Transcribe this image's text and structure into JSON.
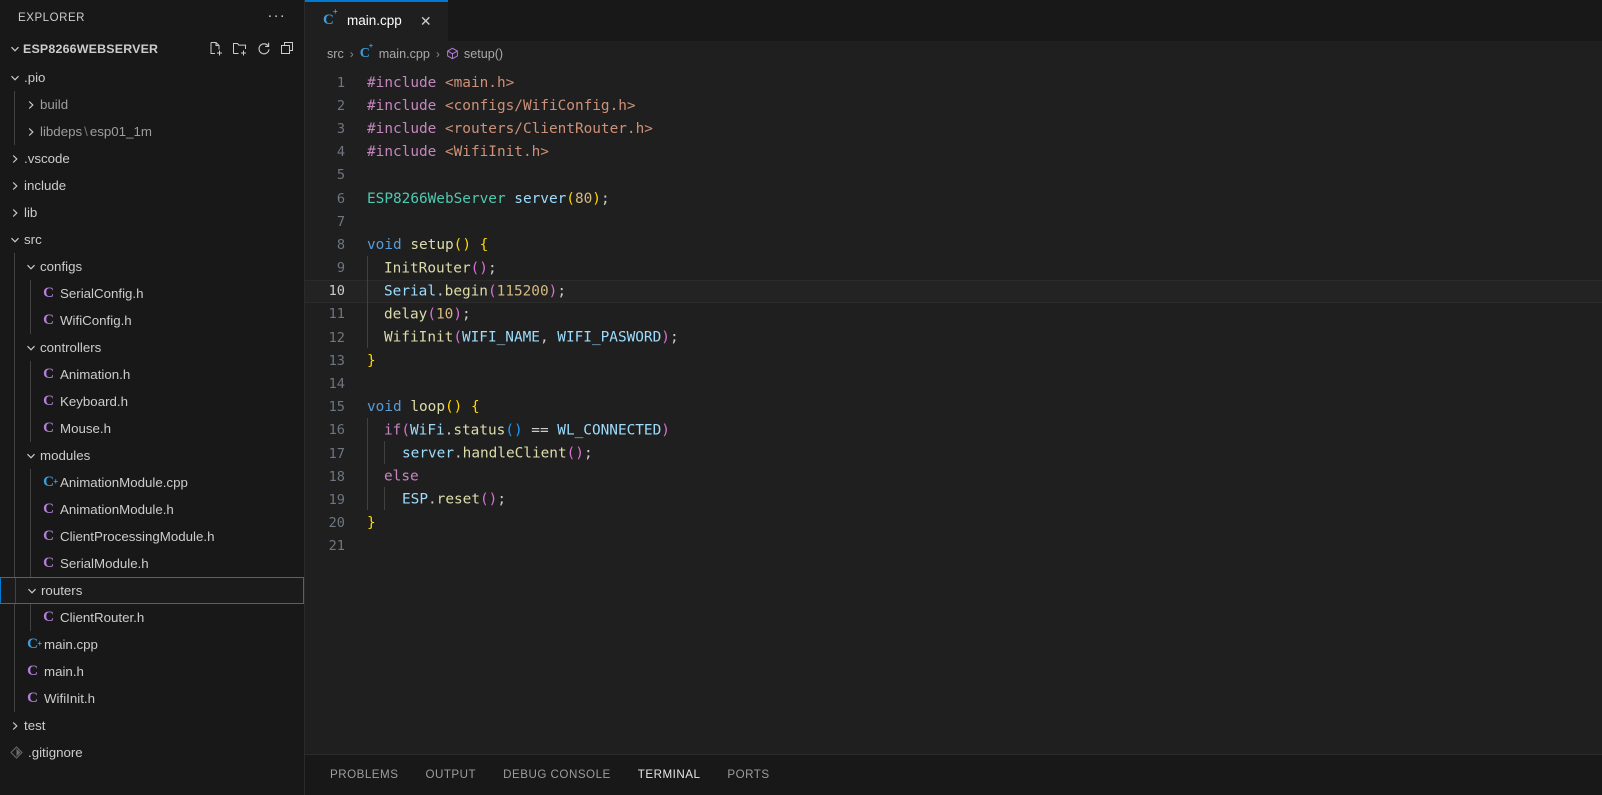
{
  "sidebar": {
    "header_title": "EXPLORER",
    "more_actions_label": "···",
    "project_name": "ESP8266WEBSERVER",
    "actions": [
      {
        "name": "new-file-icon",
        "label": "New File"
      },
      {
        "name": "new-folder-icon",
        "label": "New Folder"
      },
      {
        "name": "refresh-icon",
        "label": "Refresh Explorer"
      },
      {
        "name": "collapse-all-icon",
        "label": "Collapse Folders in Explorer"
      }
    ],
    "tree": [
      {
        "label": ".pio",
        "type": "folder",
        "state": "open",
        "depth": 0
      },
      {
        "label": "build",
        "type": "folder",
        "state": "closed",
        "depth": 1
      },
      {
        "label": "libdeps",
        "label2": "esp01_1m",
        "type": "folder",
        "state": "closed",
        "depth": 1
      },
      {
        "label": ".vscode",
        "type": "folder",
        "state": "closed",
        "depth": 0
      },
      {
        "label": "include",
        "type": "folder",
        "state": "closed",
        "depth": 0
      },
      {
        "label": "lib",
        "type": "folder",
        "state": "closed",
        "depth": 0
      },
      {
        "label": "src",
        "type": "folder",
        "state": "open",
        "depth": 0
      },
      {
        "label": "configs",
        "type": "folder",
        "state": "open",
        "depth": 1
      },
      {
        "label": "SerialConfig.h",
        "type": "header",
        "depth": 2
      },
      {
        "label": "WifiConfig.h",
        "type": "header",
        "depth": 2
      },
      {
        "label": "controllers",
        "type": "folder",
        "state": "open",
        "depth": 1
      },
      {
        "label": "Animation.h",
        "type": "header",
        "depth": 2
      },
      {
        "label": "Keyboard.h",
        "type": "header",
        "depth": 2
      },
      {
        "label": "Mouse.h",
        "type": "header",
        "depth": 2
      },
      {
        "label": "modules",
        "type": "folder",
        "state": "open",
        "depth": 1
      },
      {
        "label": "AnimationModule.cpp",
        "type": "cpp",
        "depth": 2
      },
      {
        "label": "AnimationModule.h",
        "type": "header",
        "depth": 2
      },
      {
        "label": "ClientProcessingModule.h",
        "type": "header",
        "depth": 2
      },
      {
        "label": "SerialModule.h",
        "type": "header",
        "depth": 2
      },
      {
        "label": "routers",
        "type": "folder",
        "state": "open",
        "depth": 1,
        "selected": true
      },
      {
        "label": "ClientRouter.h",
        "type": "header",
        "depth": 2
      },
      {
        "label": "main.cpp",
        "type": "cpp",
        "depth": 1
      },
      {
        "label": "main.h",
        "type": "header",
        "depth": 1
      },
      {
        "label": "WifiInit.h",
        "type": "header",
        "depth": 1
      },
      {
        "label": "test",
        "type": "folder",
        "state": "closed",
        "depth": 0
      },
      {
        "label": ".gitignore",
        "type": "git",
        "depth": 0
      }
    ]
  },
  "tabs": [
    {
      "label": "main.cpp",
      "icon": "cpp-file-icon",
      "active": true,
      "close_label": "✕"
    }
  ],
  "breadcrumb": [
    {
      "label": "src",
      "icon": null
    },
    {
      "label": "main.cpp",
      "icon": "cpp-file-icon"
    },
    {
      "label": "setup()",
      "icon": "symbol-method-icon"
    }
  ],
  "editor": {
    "active_line": 10,
    "lines": [
      {
        "n": 1,
        "tokens": [
          {
            "t": "#include",
            "c": "t-pre"
          },
          {
            "t": " ",
            "c": "t-plain"
          },
          {
            "t": "<main.h>",
            "c": "t-str"
          }
        ]
      },
      {
        "n": 2,
        "tokens": [
          {
            "t": "#include",
            "c": "t-pre"
          },
          {
            "t": " ",
            "c": "t-plain"
          },
          {
            "t": "<configs/WifiConfig.h>",
            "c": "t-str"
          }
        ]
      },
      {
        "n": 3,
        "tokens": [
          {
            "t": "#include",
            "c": "t-pre"
          },
          {
            "t": " ",
            "c": "t-plain"
          },
          {
            "t": "<routers/ClientRouter.h>",
            "c": "t-str"
          }
        ]
      },
      {
        "n": 4,
        "tokens": [
          {
            "t": "#include",
            "c": "t-pre"
          },
          {
            "t": " ",
            "c": "t-plain"
          },
          {
            "t": "<WifiInit.h>",
            "c": "t-str"
          }
        ]
      },
      {
        "n": 5,
        "tokens": []
      },
      {
        "n": 6,
        "tokens": [
          {
            "t": "ESP8266WebServer",
            "c": "t-type"
          },
          {
            "t": " ",
            "c": "t-plain"
          },
          {
            "t": "server",
            "c": "t-var"
          },
          {
            "t": "(",
            "c": "t-br1"
          },
          {
            "t": "80",
            "c": "t-num2"
          },
          {
            "t": ")",
            "c": "t-br1"
          },
          {
            "t": ";",
            "c": "t-plain"
          }
        ]
      },
      {
        "n": 7,
        "tokens": []
      },
      {
        "n": 8,
        "tokens": [
          {
            "t": "void",
            "c": "t-kw"
          },
          {
            "t": " ",
            "c": "t-plain"
          },
          {
            "t": "setup",
            "c": "t-fn"
          },
          {
            "t": "()",
            "c": "t-br1"
          },
          {
            "t": " ",
            "c": "t-plain"
          },
          {
            "t": "{",
            "c": "t-br1"
          }
        ]
      },
      {
        "n": 9,
        "indent": 1,
        "tokens": [
          {
            "t": "InitRouter",
            "c": "t-fn"
          },
          {
            "t": "()",
            "c": "t-br2"
          },
          {
            "t": ";",
            "c": "t-plain"
          }
        ]
      },
      {
        "n": 10,
        "indent": 1,
        "tokens": [
          {
            "t": "Serial",
            "c": "t-var"
          },
          {
            "t": ".",
            "c": "t-plain"
          },
          {
            "t": "begin",
            "c": "t-fn"
          },
          {
            "t": "(",
            "c": "t-br2"
          },
          {
            "t": "115200",
            "c": "t-num2"
          },
          {
            "t": ")",
            "c": "t-br2"
          },
          {
            "t": ";",
            "c": "t-plain"
          }
        ]
      },
      {
        "n": 11,
        "indent": 1,
        "tokens": [
          {
            "t": "delay",
            "c": "t-fn"
          },
          {
            "t": "(",
            "c": "t-br2"
          },
          {
            "t": "10",
            "c": "t-num2"
          },
          {
            "t": ")",
            "c": "t-br2"
          },
          {
            "t": ";",
            "c": "t-plain"
          }
        ]
      },
      {
        "n": 12,
        "indent": 1,
        "tokens": [
          {
            "t": "WifiInit",
            "c": "t-fn"
          },
          {
            "t": "(",
            "c": "t-br2"
          },
          {
            "t": "WIFI_NAME",
            "c": "t-var"
          },
          {
            "t": ", ",
            "c": "t-plain"
          },
          {
            "t": "WIFI_PASWORD",
            "c": "t-var"
          },
          {
            "t": ")",
            "c": "t-br2"
          },
          {
            "t": ";",
            "c": "t-plain"
          }
        ]
      },
      {
        "n": 13,
        "tokens": [
          {
            "t": "}",
            "c": "t-br1"
          }
        ]
      },
      {
        "n": 14,
        "tokens": []
      },
      {
        "n": 15,
        "tokens": [
          {
            "t": "void",
            "c": "t-kw"
          },
          {
            "t": " ",
            "c": "t-plain"
          },
          {
            "t": "loop",
            "c": "t-fn"
          },
          {
            "t": "()",
            "c": "t-br1"
          },
          {
            "t": " ",
            "c": "t-plain"
          },
          {
            "t": "{",
            "c": "t-br1"
          }
        ]
      },
      {
        "n": 16,
        "indent": 1,
        "tokens": [
          {
            "t": "if",
            "c": "t-pre"
          },
          {
            "t": "(",
            "c": "t-br2"
          },
          {
            "t": "WiFi",
            "c": "t-var"
          },
          {
            "t": ".",
            "c": "t-plain"
          },
          {
            "t": "status",
            "c": "t-fn"
          },
          {
            "t": "()",
            "c": "t-br3"
          },
          {
            "t": " == ",
            "c": "t-plain"
          },
          {
            "t": "WL_CONNECTED",
            "c": "t-var"
          },
          {
            "t": ")",
            "c": "t-br2"
          }
        ]
      },
      {
        "n": 17,
        "indent": 2,
        "tokens": [
          {
            "t": "server",
            "c": "t-var"
          },
          {
            "t": ".",
            "c": "t-plain"
          },
          {
            "t": "handleClient",
            "c": "t-fn"
          },
          {
            "t": "()",
            "c": "t-br2"
          },
          {
            "t": ";",
            "c": "t-plain"
          }
        ]
      },
      {
        "n": 18,
        "indent": 1,
        "tokens": [
          {
            "t": "else",
            "c": "t-pre"
          }
        ]
      },
      {
        "n": 19,
        "indent": 2,
        "tokens": [
          {
            "t": "ESP",
            "c": "t-var"
          },
          {
            "t": ".",
            "c": "t-plain"
          },
          {
            "t": "reset",
            "c": "t-fn"
          },
          {
            "t": "()",
            "c": "t-br2"
          },
          {
            "t": ";",
            "c": "t-plain"
          }
        ]
      },
      {
        "n": 20,
        "tokens": [
          {
            "t": "}",
            "c": "t-br1"
          }
        ]
      },
      {
        "n": 21,
        "tokens": []
      }
    ]
  },
  "panel": {
    "tabs": [
      {
        "label": "PROBLEMS",
        "active": false
      },
      {
        "label": "OUTPUT",
        "active": false
      },
      {
        "label": "DEBUG CONSOLE",
        "active": false
      },
      {
        "label": "TERMINAL",
        "active": true
      },
      {
        "label": "PORTS",
        "active": false
      }
    ]
  },
  "colors": {
    "accent": "#0078d4",
    "sidebar_bg": "#181818",
    "editor_bg": "#1f1f1f",
    "text": "#cccccc"
  }
}
